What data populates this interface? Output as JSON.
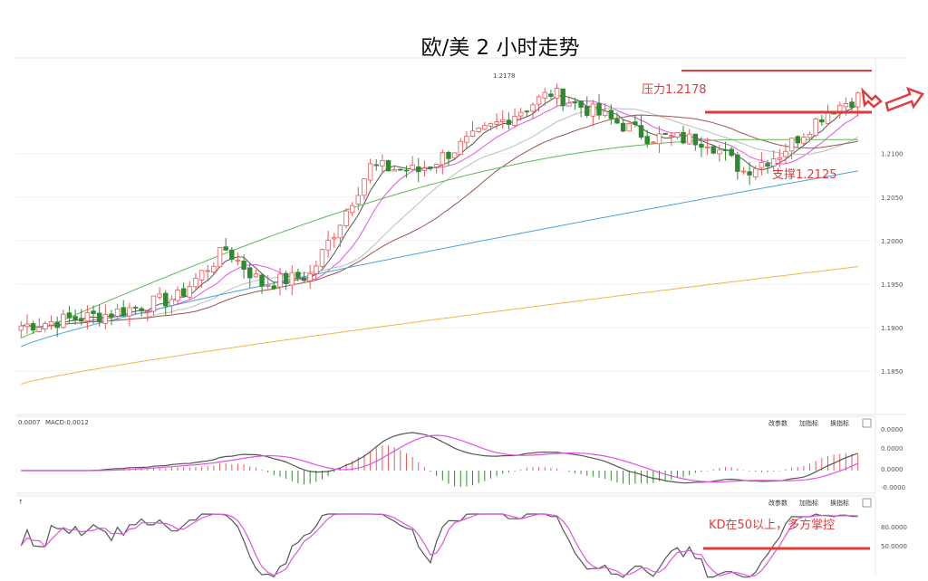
{
  "title": "欧/美 2 小时走势",
  "colors": {
    "up": "#e8585a",
    "down": "#2f8a2f",
    "ma5": "#555555",
    "ma10": "#e055e0",
    "ma20": "#bdbdbd",
    "ma30": "#a0524d",
    "ma60": "#5cb85c",
    "ma120": "#4aa3df",
    "ma250": "#f0b44c",
    "annotation": "#e23b3b",
    "dif": "#555555",
    "dea": "#e055e0"
  },
  "chart_data": [
    {
      "type": "candlestick",
      "yticks": [
        "1.2100",
        "1.2050",
        "1.2000",
        "1.1950",
        "1.1900",
        "1.1850"
      ],
      "ylim": [
        1.18,
        1.221
      ],
      "high_label": "1.2178",
      "annotations": {
        "resistance": "压力1.2178",
        "support": "支撑1.2125"
      },
      "resistance_level": 1.2178,
      "support_level": 1.2125
    },
    {
      "type": "bar",
      "name": "MACD",
      "header_left": "0.0007",
      "header_macd": "MACD:0.0012",
      "yticks": [
        "0.0000",
        "0.0000",
        "0.0000",
        "-0.0000"
      ],
      "buttons": [
        "改参数",
        "加指标",
        "换指标"
      ]
    },
    {
      "type": "line",
      "name": "KD",
      "yticks": [
        "80.0000",
        "50.0000"
      ],
      "buttons": [
        "改参数",
        "加指标",
        "换指标"
      ],
      "annotation": "KD在50以上，多方掌控",
      "level": 50
    }
  ]
}
